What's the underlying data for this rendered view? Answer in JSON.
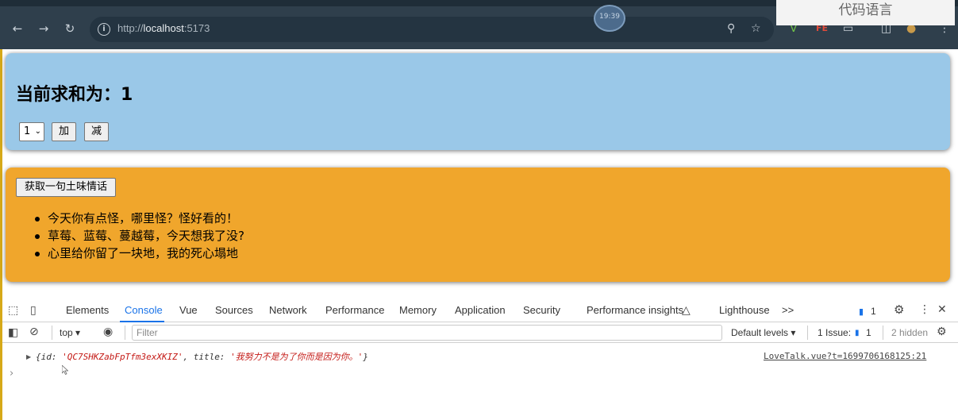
{
  "browser": {
    "url_scheme": "http://",
    "url_host": "localhost",
    "url_port": ":5173",
    "clock": "19:39",
    "watermark": "代码语言"
  },
  "count_card": {
    "title": "当前求和为：1",
    "select_value": "1",
    "add_label": "加",
    "minus_label": "减"
  },
  "love_talk": {
    "fetch_button_label": "获取一句土味情话",
    "items": [
      "今天你有点怪，哪里怪？怪好看的！",
      "草莓、蓝莓、蔓越莓，今天想我了没?",
      "心里给你留了一块地，我的死心塌地"
    ]
  },
  "devtools": {
    "tabs": [
      "Elements",
      "Console",
      "Vue",
      "Sources",
      "Network",
      "Performance",
      "Memory",
      "Application",
      "Security",
      "Performance insights",
      "Lighthouse"
    ],
    "active_tab": "Console",
    "more_tabs": ">>",
    "messages_count": "1",
    "context": "top",
    "filter_placeholder": "Filter",
    "default_levels": "Default levels",
    "issues_label": "1 Issue:",
    "issues_count": "1",
    "hidden": "2 hidden",
    "log_prefix": "{id: ",
    "log_id": "'QC7SHKZabFpTfm3exXKIZ'",
    "log_mid": ", title: ",
    "log_title": "'我努力不是为了你而是因为你。'",
    "log_suffix": "}",
    "log_source": "LoveTalk.vue?t=1699706168125:21"
  }
}
